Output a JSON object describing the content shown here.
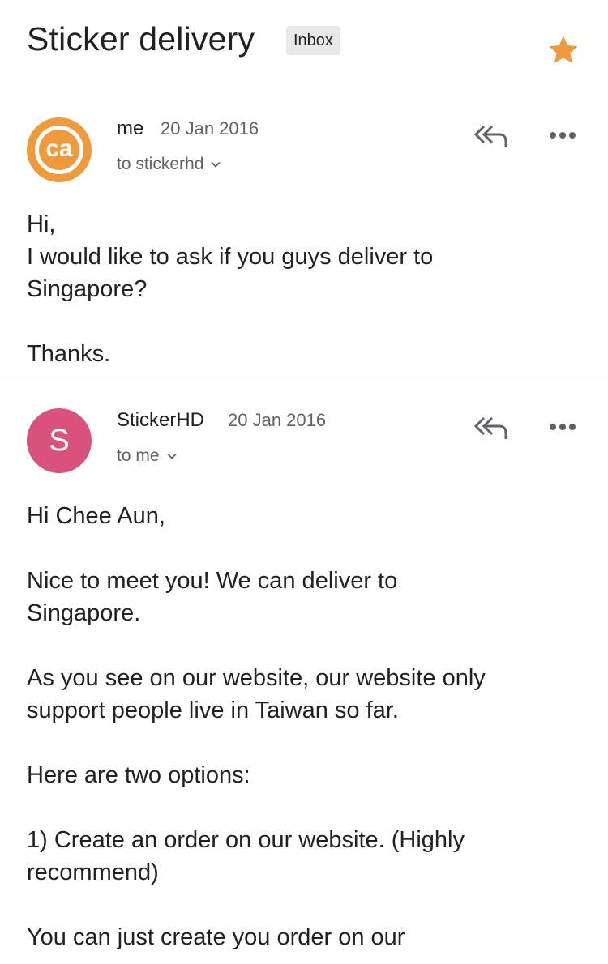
{
  "thread": {
    "subject": "Sticker delivery",
    "label": "Inbox",
    "starred": true,
    "star_color": "#ef9a3c"
  },
  "messages": [
    {
      "avatar_text": "ca",
      "avatar_color": "#ef9a3c",
      "sender": "me",
      "date": "20 Jan 2016",
      "recipient": "to stickerhd",
      "body": [
        "Hi,",
        "I would like to ask if you guys deliver to",
        "Singapore?",
        "",
        "Thanks."
      ]
    },
    {
      "avatar_text": "S",
      "avatar_color": "#d9527d",
      "sender": "StickerHD",
      "date": "20 Jan 2016",
      "recipient": "to me",
      "body": [
        "Hi Chee Aun,",
        "",
        "Nice to meet you! We can deliver to",
        "Singapore.",
        "",
        "As you see on our website, our website only",
        "support people live in Taiwan so far.",
        "",
        "Here are two options:",
        "",
        "1) Create an order on our website. (Highly",
        "recommend)",
        "",
        "You can just create you order on our"
      ]
    }
  ],
  "icons": {
    "star": "star-icon",
    "reply_all": "reply-all-icon",
    "more": "more-options-icon",
    "chevron": "chevron-down-icon"
  }
}
